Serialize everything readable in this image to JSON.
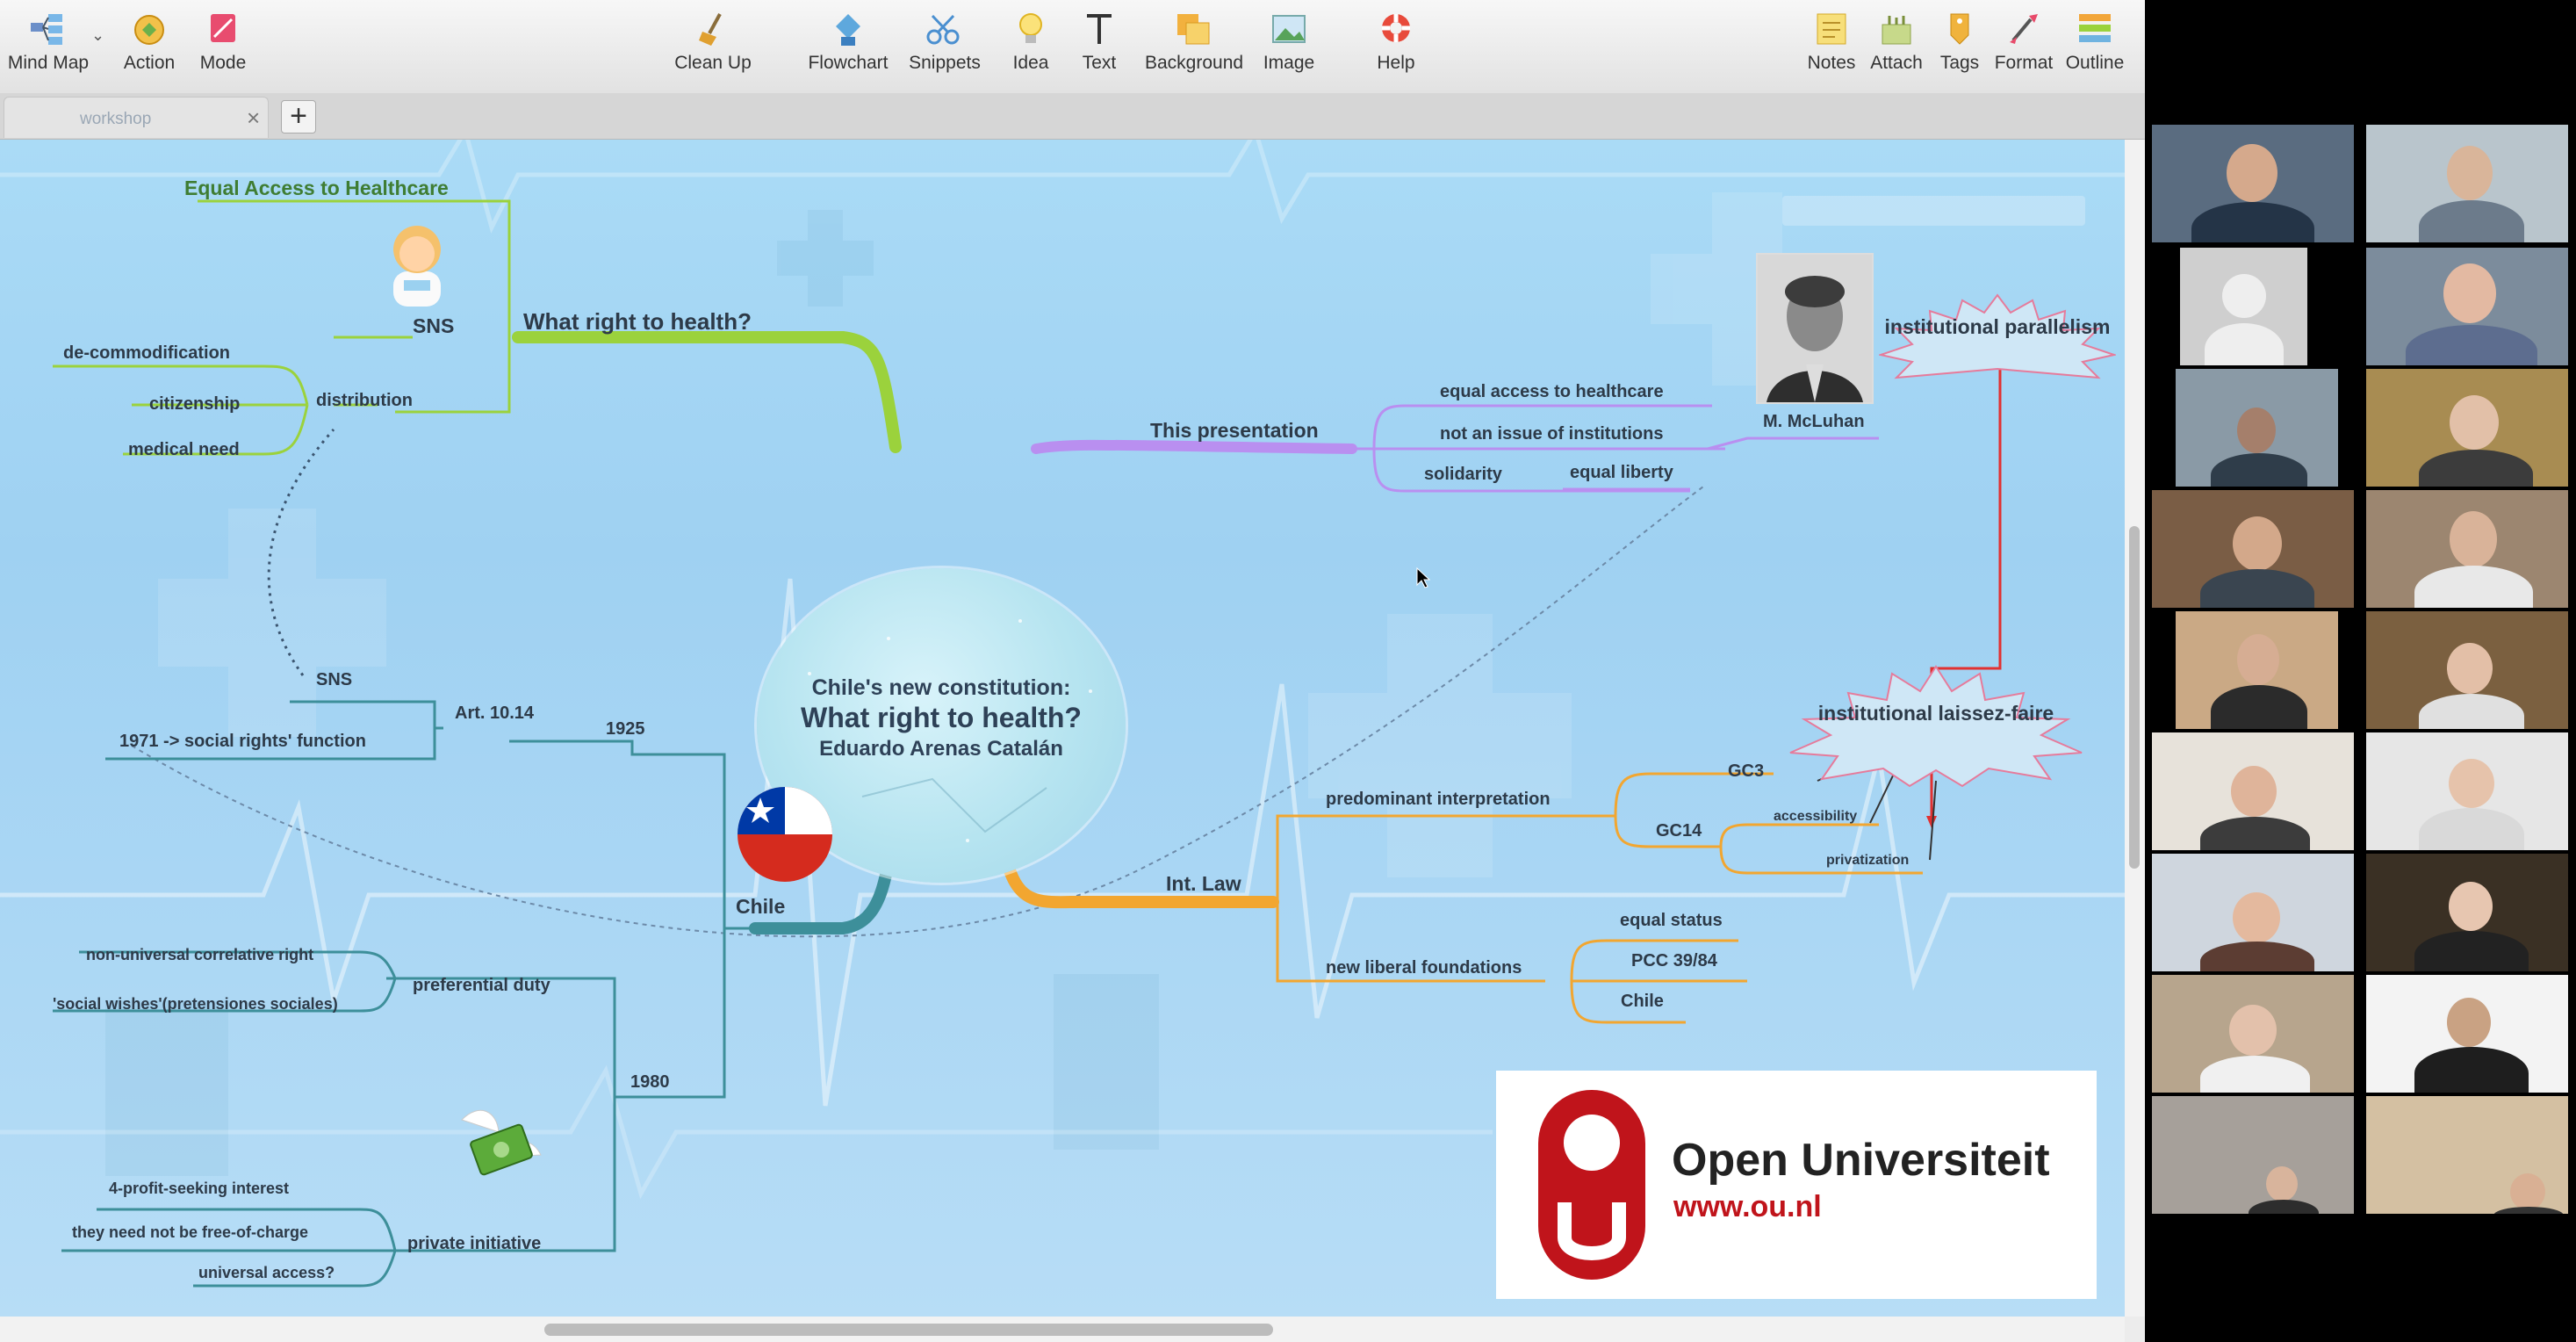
{
  "toolbar": {
    "left": [
      {
        "label": "Mind Map",
        "icon": "mind-map-icon"
      },
      {
        "label": "Action",
        "icon": "action-icon"
      },
      {
        "label": "Mode",
        "icon": "mode-icon"
      }
    ],
    "center": [
      {
        "label": "Clean Up",
        "icon": "broom-icon"
      },
      {
        "label": "Flowchart",
        "icon": "flowchart-icon"
      },
      {
        "label": "Snippets",
        "icon": "scissors-icon"
      },
      {
        "label": "Idea",
        "icon": "lightbulb-icon"
      },
      {
        "label": "Text",
        "icon": "text-icon"
      },
      {
        "label": "Background",
        "icon": "background-icon"
      },
      {
        "label": "Image",
        "icon": "image-icon"
      },
      {
        "label": "Help",
        "icon": "lifebuoy-icon"
      }
    ],
    "right": [
      {
        "label": "Notes",
        "icon": "notes-icon"
      },
      {
        "label": "Attach",
        "icon": "attach-icon"
      },
      {
        "label": "Tags",
        "icon": "tag-icon"
      },
      {
        "label": "Format",
        "icon": "format-icon"
      },
      {
        "label": "Outline",
        "icon": "outline-icon"
      }
    ]
  },
  "tabs": [
    {
      "label": "workshop",
      "close": "×"
    }
  ],
  "add_tab": "+",
  "map": {
    "root": {
      "line1": "Chile's new constitution:",
      "line2": "What right to health?",
      "line3": "Eduardo Arenas Catalán"
    },
    "what_right": {
      "label": "What right to health?",
      "sns": "SNS",
      "equal_access": "Equal Access to Healthcare",
      "distribution": "distribution",
      "decommodification": "de-commodification",
      "citizenship": "citizenship",
      "medical_need": "medical need"
    },
    "this_presentation": {
      "label": "This presentation",
      "items": [
        "equal access to healthcare",
        "not an issue of institutions",
        "solidarity"
      ],
      "equal_liberty": "equal liberty",
      "mcluhan": "M. McLuhan",
      "parallelism": "institutional parallelism",
      "laissez_faire": "institutional laissez-faire"
    },
    "int_law": {
      "label": "Int. Law",
      "predominant": "predominant interpretation",
      "gc3": "GC3",
      "gc14": "GC14",
      "accessibility": "accessibility",
      "privatization": "privatization",
      "new_liberal": "new liberal foundations",
      "equal_status": "equal status",
      "pcc": "PCC 39/84",
      "chile": "Chile"
    },
    "chile": {
      "label": "Chile",
      "y1925": "1925",
      "art": "Art. 10.14",
      "sns": "SNS",
      "social_rights": "1971 -> social rights'  function",
      "y1980": "1980",
      "preferential": "preferential duty",
      "non_universal": "non-universal correlative right",
      "social_wishes": "'social wishes'(pretensiones sociales)",
      "private": "private initiative",
      "profit": "4-profit-seeking interest",
      "free": "they need not be free-of-charge",
      "universal": "universal access?"
    }
  },
  "logo": {
    "name": "Open Universiteit",
    "url": "www.ou.nl",
    "colors": {
      "red": "#c0141b"
    }
  },
  "colors": {
    "green_branch": "#9bd23c",
    "purple_branch": "#b98ff0",
    "orange_branch": "#f2a630",
    "teal_branch": "#3d8f9a",
    "red_arrow": "#e23131"
  }
}
